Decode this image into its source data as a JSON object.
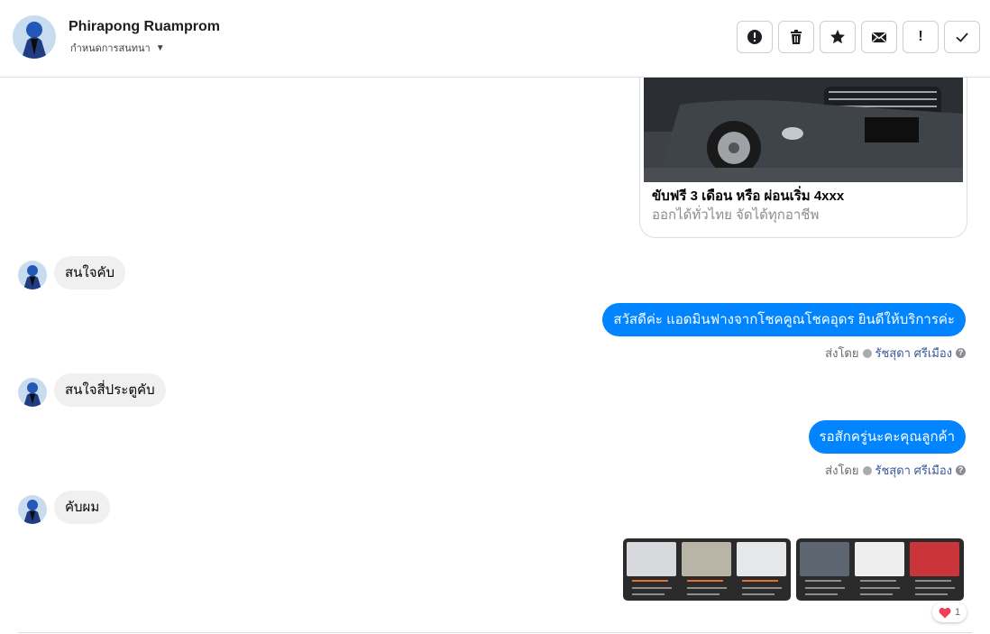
{
  "header": {
    "contact_name": "Phirapong Ruamprom",
    "assign_label": "กำหนดการสนทนา",
    "toolbar": [
      {
        "icon": "alert-circle-icon",
        "label": ""
      },
      {
        "icon": "trash-icon",
        "label": ""
      },
      {
        "icon": "star-icon",
        "label": ""
      },
      {
        "icon": "envelope-icon",
        "label": ""
      },
      {
        "icon": "exclamation-icon",
        "label": "!"
      },
      {
        "icon": "checkmark-icon",
        "label": ""
      }
    ]
  },
  "link_card": {
    "title": "ขับฟรี 3 เดือน หรือ ผ่อนเริ่ม 4xxx",
    "description": "ออกได้ทั่วไทย จัดได้ทุกอาชีพ"
  },
  "messages": {
    "m1": {
      "text": "สนใจคับ"
    },
    "m2": {
      "text": "สวัสดีค่ะ แอดมินฟางจากโชคคูณโชคอุดร ยินดีให้บริการค่ะ"
    },
    "m3": {
      "text": "สนใจสี่ประตูคับ"
    },
    "m4": {
      "text": "รอสักครู่นะคะคุณลูกค้า"
    },
    "m5": {
      "text": "คับผม"
    }
  },
  "sent_by": {
    "prefix": "ส่งโดย",
    "agent": "รัชสุดา ศรีเมือง"
  },
  "reaction": {
    "emoji": "❤️",
    "count": "1"
  },
  "colors": {
    "outgoing": "#0084ff",
    "incoming": "#f0f0f0",
    "link": "#385898"
  }
}
